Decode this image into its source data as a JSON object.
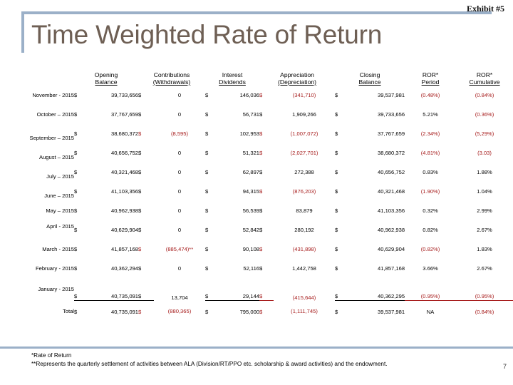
{
  "slide": {
    "title": "Time Weighted Rate of Return",
    "exhibit_label": "Exhibit #5",
    "slide_number": "7",
    "accent_color": "#9BB0C8",
    "title_color": "#6E5F54",
    "negative_color": "#A61B1B"
  },
  "table": {
    "headers_top": [
      "",
      "Opening",
      "Contributions",
      "Interest",
      "Appreciation",
      "Closing",
      "ROR*",
      "ROR*"
    ],
    "headers_bottom": [
      "",
      "Balance",
      "(Withdrawals)",
      "Dividends",
      "(Depreciation)",
      "Balance",
      "Period",
      "Cumulative"
    ],
    "rows": [
      {
        "month": "November - 2015",
        "opening_cur": "$",
        "opening": "39,733,656",
        "contrib_cur": "$",
        "contrib": "0",
        "contrib_neg": false,
        "interest_cur": "$",
        "interest": "146,036",
        "apprec_cur": "$",
        "apprec": "(341,710)",
        "apprec_neg": true,
        "closing_cur": "$",
        "closing": "39,537,981",
        "ror_period": "(0.48%)",
        "ror_period_neg": true,
        "ror_cumulative": "(0.84%)",
        "ror_cumulative_neg": true
      },
      {
        "month": "October – 2015",
        "opening_cur": "$",
        "opening": "37,767,659",
        "contrib_cur": "$",
        "contrib": "0",
        "contrib_neg": false,
        "interest_cur": "$",
        "interest": "56,731",
        "apprec_cur": "$",
        "apprec": "1,909,266",
        "apprec_neg": false,
        "closing_cur": "$",
        "closing": "39,733,656",
        "ror_period": "5.21%",
        "ror_period_neg": false,
        "ror_cumulative": "(0.36%)",
        "ror_cumulative_neg": true
      },
      {
        "month": "September – 2015",
        "opening_cur": "$",
        "opening": "38,680,372",
        "contrib_cur": "$",
        "contrib": "(8,595)",
        "contrib_neg": true,
        "interest_cur": "$",
        "interest": "102,953",
        "apprec_cur": "$",
        "apprec": "(1,007,072)",
        "apprec_neg": true,
        "closing_cur": "$",
        "closing": "37,767,659",
        "ror_period": "(2.34%)",
        "ror_period_neg": true,
        "ror_cumulative": "(5,29%)",
        "ror_cumulative_neg": true
      },
      {
        "month": "August – 2015",
        "opening_cur": "$",
        "opening": "40,656,752",
        "contrib_cur": "$",
        "contrib": "0",
        "contrib_neg": false,
        "interest_cur": "$",
        "interest": "51,321",
        "apprec_cur": "$",
        "apprec": "(2,027,701)",
        "apprec_neg": true,
        "closing_cur": "$",
        "closing": "38,680,372",
        "ror_period": "(4.81%)",
        "ror_period_neg": true,
        "ror_cumulative": "(3.03)",
        "ror_cumulative_neg": true
      },
      {
        "month": "July – 2015",
        "opening_cur": "$",
        "opening": "40,321,468",
        "contrib_cur": "$",
        "contrib": "0",
        "contrib_neg": false,
        "interest_cur": "$",
        "interest": "62,897",
        "apprec_cur": "$",
        "apprec": "272,388",
        "apprec_neg": false,
        "closing_cur": "$",
        "closing": "40,656,752",
        "ror_period": "0.83%",
        "ror_period_neg": false,
        "ror_cumulative": "1.88%",
        "ror_cumulative_neg": false
      },
      {
        "month": "June – 2015",
        "opening_cur": "$",
        "opening": "41,103,356",
        "contrib_cur": "$",
        "contrib": "0",
        "contrib_neg": false,
        "interest_cur": "$",
        "interest": "94,315",
        "apprec_cur": "$",
        "apprec": "(876,203)",
        "apprec_neg": true,
        "closing_cur": "$",
        "closing": "40,321,468",
        "ror_period": "(1.90%)",
        "ror_period_neg": true,
        "ror_cumulative": "1.04%",
        "ror_cumulative_neg": false
      },
      {
        "month": "May – 2015",
        "opening_cur": "$",
        "opening": "40,962,938",
        "contrib_cur": "$",
        "contrib": "0",
        "contrib_neg": false,
        "interest_cur": "$",
        "interest": "56,539",
        "apprec_cur": "$",
        "apprec": "83,879",
        "apprec_neg": false,
        "closing_cur": "$",
        "closing": "41,103,356",
        "ror_period": "0.32%",
        "ror_period_neg": false,
        "ror_cumulative": "2.99%",
        "ror_cumulative_neg": false
      },
      {
        "month": "April - 2015",
        "opening_cur": "$",
        "opening": "40,629,904",
        "contrib_cur": "$",
        "contrib": "0",
        "contrib_neg": false,
        "interest_cur": "$",
        "interest": "52,842",
        "apprec_cur": "$",
        "apprec": "280,192",
        "apprec_neg": false,
        "closing_cur": "$",
        "closing": "40,962,938",
        "ror_period": "0.82%",
        "ror_period_neg": false,
        "ror_cumulative": "2.67%",
        "ror_cumulative_neg": false
      },
      {
        "month": "March - 2015",
        "opening_cur": "$",
        "opening": "41,857,168",
        "contrib_cur": "$",
        "contrib": "(885,474)**",
        "contrib_neg": true,
        "interest_cur": "$",
        "interest": "90,108",
        "apprec_cur": "$",
        "apprec": "(431,898)",
        "apprec_neg": true,
        "closing_cur": "$",
        "closing": "40,629,904",
        "ror_period": "(0.82%)",
        "ror_period_neg": true,
        "ror_cumulative": "1.83%",
        "ror_cumulative_neg": false
      },
      {
        "month": "February - 2015",
        "opening_cur": "$",
        "opening": "40,362,294",
        "contrib_cur": "$",
        "contrib": "0",
        "contrib_neg": false,
        "interest_cur": "$",
        "interest": "52,116",
        "apprec_cur": "$",
        "apprec": "1,442,758",
        "apprec_neg": false,
        "closing_cur": "$",
        "closing": "41,857,168",
        "ror_period": "3.66%",
        "ror_period_neg": false,
        "ror_cumulative": "2.67%",
        "ror_cumulative_neg": false
      },
      {
        "month": "January - 2015",
        "opening_cur": "$",
        "opening": "40,735,091",
        "contrib_cur": "$",
        "contrib": "13,704",
        "contrib_neg": false,
        "interest_cur": "$",
        "interest": "29,144",
        "apprec_cur": "$",
        "apprec": "(415,644)",
        "apprec_neg": true,
        "closing_cur": "$",
        "closing": "40,362,295",
        "ror_period": "(0.95%)",
        "ror_period_neg": true,
        "ror_cumulative": "(0.95%)",
        "ror_cumulative_neg": true
      }
    ],
    "total_row": {
      "month": "Total",
      "opening_cur": "$",
      "opening": "40,735,091",
      "contrib_cur": "$",
      "contrib": "(880,365)",
      "contrib_neg": true,
      "interest_cur": "$",
      "interest": "795,000",
      "apprec_cur": "$",
      "apprec": "(1,111,745)",
      "apprec_neg": true,
      "closing_cur": "$",
      "closing": "39,537,981",
      "ror_period": "NA",
      "ror_period_neg": false,
      "ror_cumulative": "(0.84%)",
      "ror_cumulative_neg": true
    }
  },
  "footnotes": {
    "line1": "*Rate of Return",
    "line2": "**Represents the quarterly settlement of activities between ALA (Division/RT/PPO etc. scholarship & award activities) and the endowment."
  }
}
